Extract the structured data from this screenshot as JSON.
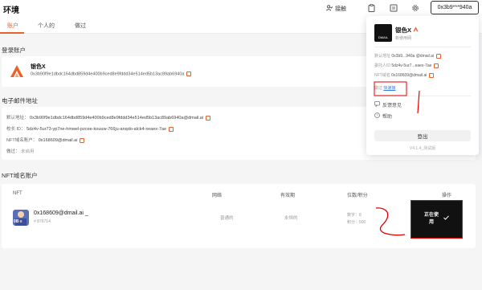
{
  "header": {
    "title": "环境",
    "sign_label": "接触",
    "address_short": "0x3b9***940a"
  },
  "tabs": [
    {
      "label": "账户",
      "active": true
    },
    {
      "label": "个人的",
      "active": false
    },
    {
      "label": "做过",
      "active": false
    }
  ],
  "login_section": {
    "title": "登录账户",
    "account_name": "银色X",
    "account_address": "0x3b90f9e1dbdc164dbd859d4e400b9ced8e9fddd34e514ed5b13ac89ab6940a"
  },
  "email_section": {
    "title": "电子邮件地址",
    "rows": [
      {
        "label": "默认地址：",
        "value": "0x3b90f9e1dbdc164dbd859d4e400b9ced8e9fddd34e514ed5b13ac89ab6940a@dmail.ai",
        "copy": true
      },
      {
        "label": "校长 ID：",
        "value": "5dz4v-5ur73-yp7ne-hmwel-pzcee-kouuw-766ju-anqdo-alck4-xeaex-7ae",
        "copy": true
      },
      {
        "label": "NFT域名账户：",
        "value": "0x168609@dmail.ai",
        "copy": true
      },
      {
        "label": "做过：",
        "value": "未启用",
        "copy": false
      }
    ]
  },
  "nft_section": {
    "title": "NFT域名账户",
    "columns": [
      "NFT",
      "网络",
      "有效期",
      "位数/积分",
      "操作"
    ],
    "row": {
      "name": "0x168609@dmail.ai _",
      "id": "# 876714",
      "avatar_label": "0B ≤",
      "network": "普通的",
      "validity": "永恒的",
      "digits_label": "数字：8",
      "points_label": "积分：500",
      "action_line1": "正在使",
      "action_line2": "用"
    }
  },
  "popup": {
    "name": "银色X",
    "subtitle": "新使用网",
    "logo_text": "DMAIL",
    "rows": [
      {
        "label": "默认地址",
        "value": "0x3b9...940a @dmail.ai"
      },
      {
        "label": "委托人ID",
        "value": "5dz4v-5ur7...eaex-7ae"
      },
      {
        "label": "NFT域名",
        "value": "0x168609@dmail.ai"
      }
    ],
    "done_label": "做过",
    "done_link": "快速接",
    "feedback_label": "反馈意见",
    "help_label": "帮助",
    "logout_label": "登出",
    "version": "V4.1.4_测试版"
  },
  "colors": {
    "accent": "#e8632a",
    "link": "#2f7be5",
    "annotation": "#e00000"
  }
}
